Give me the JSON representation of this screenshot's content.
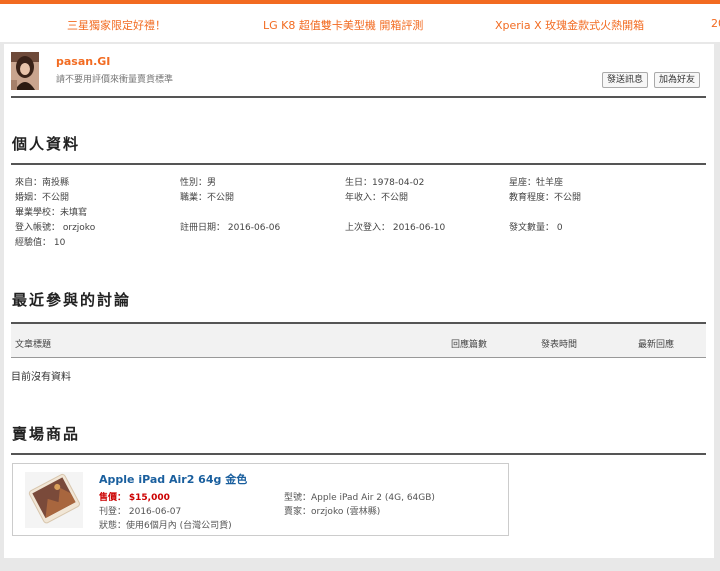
{
  "ticker": {
    "items": [
      "三星獨家限定好禮！",
      "LG K8 超值雙卡美型機 開箱評測",
      "Xperia X 玫瑰金款式火熱開箱",
      "20"
    ]
  },
  "profile": {
    "username": "pasan.GI",
    "signature": "請不要用評價來衝量賣貨標準",
    "send_message_label": "發送訊息",
    "add_friend_label": "加為好友"
  },
  "personal": {
    "heading": "個人資料",
    "fields": [
      "來自：南投縣",
      "性別：男",
      "生日：1978-04-02",
      "星座：牡羊座",
      "婚姻：不公開",
      "職業：不公開",
      "年收入：不公開",
      "教育程度：不公開",
      "畢業學校：未填寫",
      "登入帳號： orzjoko",
      "註冊日期： 2016-06-06",
      "上次登入： 2016-06-10",
      "發文數量： 0",
      "經驗值： 10"
    ]
  },
  "discussions": {
    "heading": "最近參與的討論",
    "columns": [
      "文章標題",
      "回應篇數",
      "發表時間",
      "最新回應"
    ],
    "empty_text": "目前沒有資料"
  },
  "market": {
    "heading": "賣場商品",
    "product": {
      "title": "Apple iPad Air2 64g 金色",
      "price_label": "售價：",
      "price": "$15,000",
      "date": "刊登： 2016-06-07",
      "condition": "狀態：使用6個月內 (台灣公司貨)",
      "model": "型號：Apple iPad Air 2 (4G, 64GB)",
      "seller": "賣家：orzjoko (雲林縣)"
    }
  },
  "colors": {
    "accent": "#f26b21",
    "link": "#1a5f9e",
    "price": "#cc0000"
  },
  "icons": {
    "avatar": "user-avatar",
    "thumbnail": "ipad-thumbnail"
  }
}
